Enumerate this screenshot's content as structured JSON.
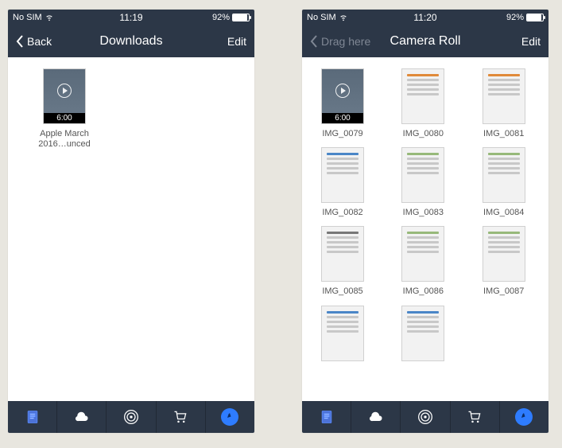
{
  "left": {
    "status": {
      "carrier": "No SIM",
      "time": "11:19",
      "battery_text": "92%",
      "battery_pct": 92
    },
    "nav": {
      "back_label": "Back",
      "title": "Downloads",
      "edit_label": "Edit",
      "back_dim": false
    },
    "items": [
      {
        "kind": "video",
        "duration": "6:00",
        "caption": "Apple March 2016…unced"
      }
    ]
  },
  "right": {
    "status": {
      "carrier": "No SIM",
      "time": "11:20",
      "battery_text": "92%",
      "battery_pct": 92
    },
    "nav": {
      "back_label": "Drag here",
      "title": "Camera Roll",
      "edit_label": "Edit",
      "back_dim": true
    },
    "items": [
      {
        "kind": "video",
        "duration": "6:00",
        "caption": "IMG_0079"
      },
      {
        "kind": "shot",
        "variant": "orange",
        "caption": "IMG_0080"
      },
      {
        "kind": "shot",
        "variant": "orange",
        "caption": "IMG_0081"
      },
      {
        "kind": "shot",
        "variant": "blue",
        "caption": "IMG_0082"
      },
      {
        "kind": "shot",
        "variant": "green",
        "caption": "IMG_0083"
      },
      {
        "kind": "shot",
        "variant": "green",
        "caption": "IMG_0084"
      },
      {
        "kind": "shot",
        "variant": "grey",
        "caption": "IMG_0085"
      },
      {
        "kind": "shot",
        "variant": "green",
        "caption": "IMG_0086"
      },
      {
        "kind": "shot",
        "variant": "green",
        "caption": "IMG_0087"
      },
      {
        "kind": "shot",
        "variant": "blue",
        "caption": ""
      },
      {
        "kind": "shot",
        "variant": "blue",
        "caption": ""
      }
    ]
  },
  "tabbar_icons": [
    "document-icon",
    "cloud-icon",
    "hotspot-icon",
    "cart-icon",
    "compass-icon"
  ],
  "colors": {
    "header": "#2c3747",
    "accent": "#2e7cff"
  }
}
